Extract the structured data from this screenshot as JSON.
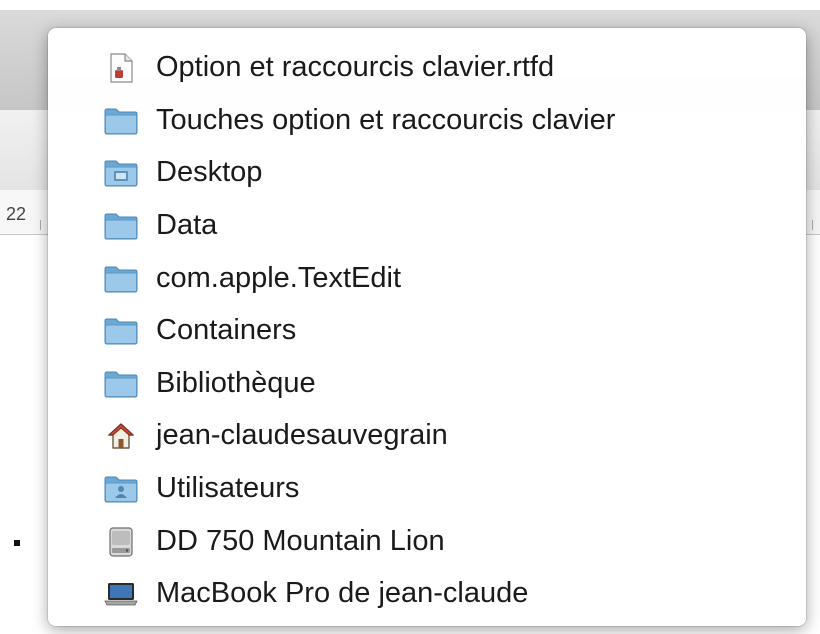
{
  "background": {
    "ruler_label": "22"
  },
  "menu": {
    "items": [
      {
        "label": "Option et raccourcis clavier.rtfd",
        "icon": "rtfd-document-icon"
      },
      {
        "label": "Touches option et raccourcis clavier",
        "icon": "folder-icon"
      },
      {
        "label": "Desktop",
        "icon": "desktop-folder-icon"
      },
      {
        "label": "Data",
        "icon": "folder-icon"
      },
      {
        "label": "com.apple.TextEdit",
        "icon": "folder-icon"
      },
      {
        "label": "Containers",
        "icon": "folder-icon"
      },
      {
        "label": "Bibliothèque",
        "icon": "folder-icon"
      },
      {
        "label": "jean-claudesauvegrain",
        "icon": "home-icon"
      },
      {
        "label": "Utilisateurs",
        "icon": "users-folder-icon"
      },
      {
        "label": "DD 750 Mountain Lion",
        "icon": "hard-drive-icon"
      },
      {
        "label": "MacBook Pro de jean-claude",
        "icon": "laptop-icon"
      }
    ]
  }
}
